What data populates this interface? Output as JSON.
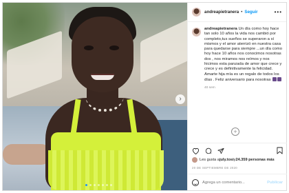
{
  "post": {
    "username": "andreapietranera",
    "separator": "•",
    "follow_label": "Seguir",
    "more_icon": "•••",
    "caption_username": "andreapietranera",
    "caption_text": "Un día como hoy hace tan solo 10 años la vida nos cambió por completo,tus sueños se superaron a sí mismos y el amor aterrizó en nuestra casa para quedarse para siempre ...un día como hoy hace 10 años nos conocimos nosotras dos , nos miramos nos reímos y nos hicimos esta panzada de amor que crece y crece y es definitivamente la felicidad. Amarte hija mía es un regalo de todos los días . Feliz aniversario para nosotras",
    "time_ago": "40 sem",
    "likes_prefix": "Les gusta a ",
    "likes_user": "july.tosi",
    "likes_joiner": " y ",
    "likes_count": "24.359 personas más",
    "date": "20 DE SEPTIEMBRE DE 2020",
    "comment_placeholder": "Agrega un comentario...",
    "publish_label": "Publicar",
    "next_label": "›",
    "load_more_label": "+"
  },
  "icons": {
    "heart": "heart-icon",
    "comment": "comment-icon",
    "share": "share-icon",
    "save": "bookmark-icon",
    "emoji": "smile-icon",
    "more": "more-options-icon"
  },
  "colors": {
    "link_blue": "#0095f6",
    "text": "#262626",
    "muted": "#8e8e8e",
    "top_color": "#d4f03a"
  }
}
